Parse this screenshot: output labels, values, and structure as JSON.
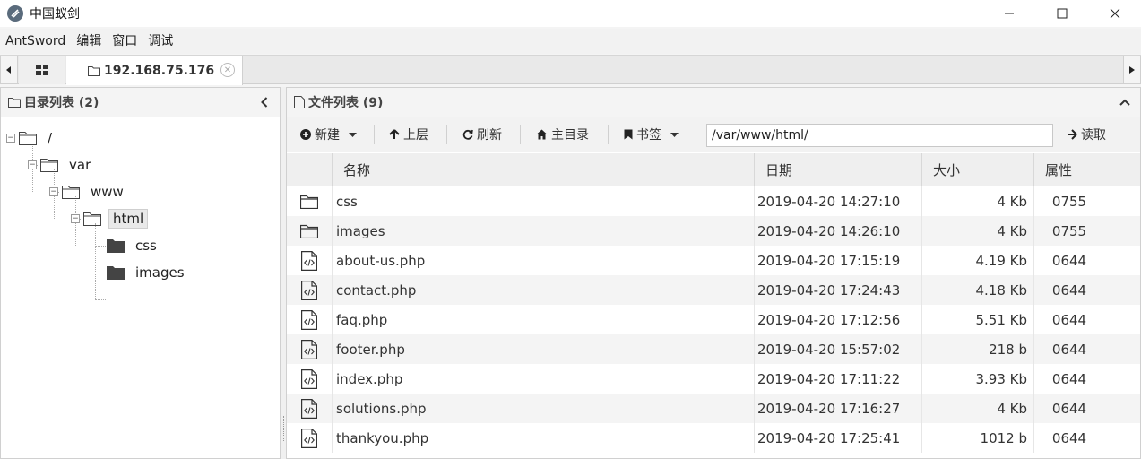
{
  "window": {
    "title": "中国蚁剑"
  },
  "menu": [
    "AntSword",
    "编辑",
    "窗口",
    "调试"
  ],
  "tabs": {
    "active_label": "192.168.75.176"
  },
  "left_panel": {
    "title": "目录列表 (2)",
    "tree": [
      {
        "label": "/",
        "level": 0,
        "expanded": true
      },
      {
        "label": "var",
        "level": 1,
        "expanded": true
      },
      {
        "label": "www",
        "level": 2,
        "expanded": true
      },
      {
        "label": "html",
        "level": 3,
        "expanded": true,
        "selected": true
      },
      {
        "label": "css",
        "level": 4,
        "leaf": true
      },
      {
        "label": "images",
        "level": 4,
        "leaf": true
      }
    ]
  },
  "right_panel": {
    "title": "文件列表 (9)",
    "toolbar": {
      "new_label": "新建",
      "up_label": "上层",
      "refresh_label": "刷新",
      "home_label": "主目录",
      "bookmark_label": "书签",
      "path_value": "/var/www/html/",
      "read_label": "读取"
    },
    "columns": [
      "名称",
      "日期",
      "大小",
      "属性"
    ],
    "files": [
      {
        "type": "folder",
        "name": "css",
        "date": "2019-04-20 14:27:10",
        "size": "4 Kb",
        "attr": "0755"
      },
      {
        "type": "folder",
        "name": "images",
        "date": "2019-04-20 14:26:10",
        "size": "4 Kb",
        "attr": "0755"
      },
      {
        "type": "code",
        "name": "about-us.php",
        "date": "2019-04-20 17:15:19",
        "size": "4.19 Kb",
        "attr": "0644"
      },
      {
        "type": "code",
        "name": "contact.php",
        "date": "2019-04-20 17:24:43",
        "size": "4.18 Kb",
        "attr": "0644"
      },
      {
        "type": "code",
        "name": "faq.php",
        "date": "2019-04-20 17:12:56",
        "size": "5.51 Kb",
        "attr": "0644"
      },
      {
        "type": "code",
        "name": "footer.php",
        "date": "2019-04-20 15:57:02",
        "size": "218 b",
        "attr": "0644"
      },
      {
        "type": "code",
        "name": "index.php",
        "date": "2019-04-20 17:11:22",
        "size": "3.93 Kb",
        "attr": "0644"
      },
      {
        "type": "code",
        "name": "solutions.php",
        "date": "2019-04-20 17:16:27",
        "size": "4 Kb",
        "attr": "0644"
      },
      {
        "type": "code",
        "name": "thankyou.php",
        "date": "2019-04-20 17:25:41",
        "size": "1012 b",
        "attr": "0644"
      }
    ]
  },
  "icons": {
    "folder_open": "folder-outline-icon",
    "folder_closed": "folder-filled-icon",
    "file": "code-file-icon"
  }
}
